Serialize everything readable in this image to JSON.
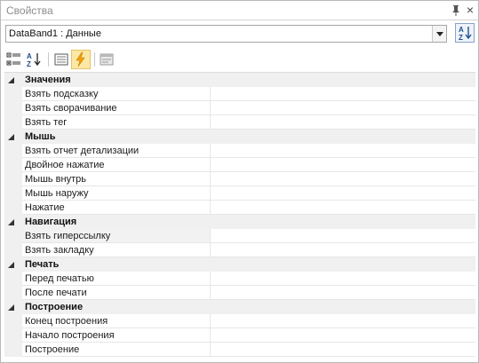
{
  "window": {
    "title": "Свойства",
    "pin_glyph": "ㅁ",
    "close_glyph": "×"
  },
  "object_selector": {
    "value": "DataBand1 : Данные"
  },
  "toolbar": {
    "icons": [
      "categorized-icon",
      "alphabetical-sort-icon",
      "properties-icon",
      "events-lightning-icon",
      "property-pages-icon"
    ],
    "active": "events-lightning-icon"
  },
  "grid": {
    "categories": [
      {
        "label": "Значения",
        "items": [
          "Взять подсказку",
          "Взять сворачивание",
          "Взять тег"
        ]
      },
      {
        "label": "Мышь",
        "items": [
          "Взять отчет детализации",
          "Двойное нажатие",
          "Мышь внутрь",
          "Мышь наружу",
          "Нажатие"
        ]
      },
      {
        "label": "Навигация",
        "items": [
          "Взять гиперссылку",
          "Взять закладку"
        ]
      },
      {
        "label": "Печать",
        "items": [
          "Перед печатью",
          "После печати"
        ]
      },
      {
        "label": "Построение",
        "items": [
          "Конец построения",
          "Начало построения",
          "Построение"
        ]
      }
    ]
  }
}
